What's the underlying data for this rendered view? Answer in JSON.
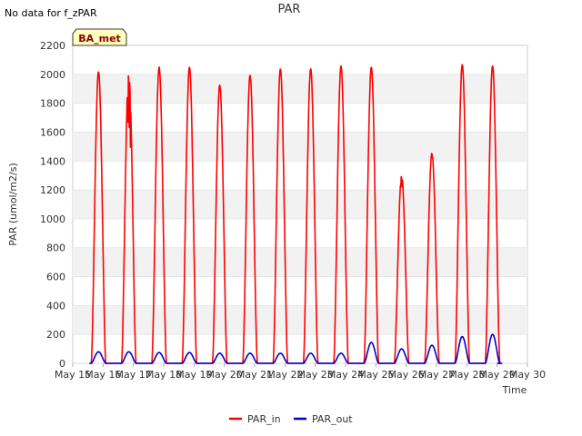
{
  "note": "No data for f_zPAR",
  "badge": "BA_met",
  "chart_data": {
    "type": "line",
    "title": "PAR",
    "xlabel": "Time",
    "ylabel": "PAR (umol/m2/s)",
    "ylim": [
      0,
      2200
    ],
    "yticks": [
      0,
      200,
      400,
      600,
      800,
      1000,
      1200,
      1400,
      1600,
      1800,
      2000,
      2200
    ],
    "xlim": [
      15,
      30
    ],
    "xticks": [
      15,
      16,
      17,
      18,
      19,
      20,
      21,
      22,
      23,
      24,
      25,
      26,
      27,
      28,
      29,
      30
    ],
    "xtick_labels": [
      "May 15",
      "May 16",
      "May 17",
      "May 18",
      "May 19",
      "May 20",
      "May 21",
      "May 22",
      "May 23",
      "May 24",
      "May 25",
      "May 26",
      "May 27",
      "May 28",
      "May 29",
      "May 30"
    ],
    "grid": "horizontal bands",
    "legend_position": "bottom-center",
    "series": [
      {
        "name": "PAR_in",
        "color": "#ff0000",
        "daily_peaks": [
          {
            "day": 15.85,
            "peak": 2020,
            "noon": 2000
          },
          {
            "day": 16.85,
            "peak": 2030,
            "noon": 1480
          },
          {
            "day": 17.85,
            "peak": 2050,
            "noon": 2050
          },
          {
            "day": 18.85,
            "peak": 2050,
            "noon": 2040
          },
          {
            "day": 19.85,
            "peak": 1930,
            "noon": 1900
          },
          {
            "day": 20.85,
            "peak": 2000,
            "noon": 1960
          },
          {
            "day": 21.85,
            "peak": 2040,
            "noon": 2020
          },
          {
            "day": 22.85,
            "peak": 2040,
            "noon": 2030
          },
          {
            "day": 23.85,
            "peak": 2060,
            "noon": 2050
          },
          {
            "day": 24.85,
            "peak": 2050,
            "noon": 2040
          },
          {
            "day": 25.85,
            "peak": 1300,
            "noon": 1190
          },
          {
            "day": 26.85,
            "peak": 1460,
            "noon": 1410
          },
          {
            "day": 27.85,
            "peak": 2070,
            "noon": 2050
          },
          {
            "day": 28.85,
            "peak": 2060,
            "noon": 2050
          }
        ]
      },
      {
        "name": "PAR_out",
        "color": "#0000cc",
        "daily_peaks": [
          {
            "day": 15.85,
            "peak": 80
          },
          {
            "day": 16.85,
            "peak": 80
          },
          {
            "day": 17.85,
            "peak": 75
          },
          {
            "day": 18.85,
            "peak": 75
          },
          {
            "day": 19.85,
            "peak": 70
          },
          {
            "day": 20.85,
            "peak": 70
          },
          {
            "day": 21.85,
            "peak": 70
          },
          {
            "day": 22.85,
            "peak": 70
          },
          {
            "day": 23.85,
            "peak": 70
          },
          {
            "day": 24.85,
            "peak": 145
          },
          {
            "day": 25.85,
            "peak": 100
          },
          {
            "day": 26.85,
            "peak": 125
          },
          {
            "day": 27.85,
            "peak": 185
          },
          {
            "day": 28.85,
            "peak": 200
          }
        ]
      }
    ]
  }
}
